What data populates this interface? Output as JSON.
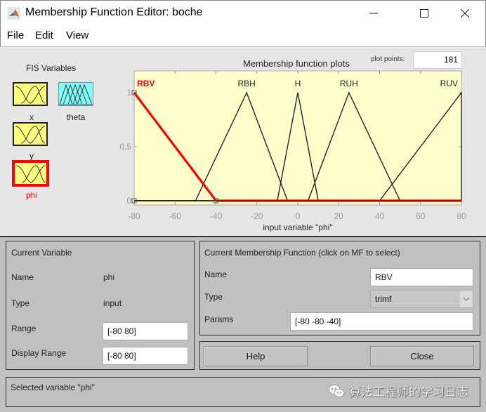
{
  "window": {
    "title": "Membership Function Editor: boche",
    "app_icon": "matlab-icon",
    "controls": [
      "minimize",
      "maximize",
      "close"
    ]
  },
  "menu": [
    {
      "label": "File"
    },
    {
      "label": "Edit"
    },
    {
      "label": "View"
    }
  ],
  "fis_variables": {
    "title": "FIS Variables",
    "items": [
      {
        "name": "x",
        "kind": "input",
        "color": "#ffff80",
        "selected": false
      },
      {
        "name": "theta",
        "kind": "output",
        "color": "#80ffff",
        "selected": false
      },
      {
        "name": "y",
        "kind": "input",
        "color": "#ffff80",
        "selected": false
      },
      {
        "name": "phi",
        "kind": "input",
        "color": "#ffff80",
        "selected": true
      }
    ],
    "selected_color": "#ff0000"
  },
  "plot_points": {
    "label": "plot points:",
    "value": "181"
  },
  "chart_data": {
    "type": "line",
    "title": "Membership function plots",
    "xlabel": "input variable \"phi\"",
    "ylabel": "",
    "xlim": [
      -80,
      80
    ],
    "ylim": [
      0,
      1
    ],
    "xticks": [
      "-80",
      "-60",
      "-40",
      "-20",
      "0",
      "20",
      "40",
      "60",
      "80"
    ],
    "yticks": [
      "0",
      "0.5",
      "1"
    ],
    "background": "#ffffcc",
    "selected_color": "#ff0000",
    "series": [
      {
        "name": "RBV",
        "mf_type": "trimf",
        "params": [
          -80,
          -80,
          -40
        ],
        "selected": true
      },
      {
        "name": "RBH",
        "mf_type": "trimf",
        "params": [
          -50,
          -25,
          -5
        ],
        "selected": false
      },
      {
        "name": "H",
        "mf_type": "trimf",
        "params": [
          -10,
          0,
          10
        ],
        "selected": false
      },
      {
        "name": "RUH",
        "mf_type": "trimf",
        "params": [
          5,
          25,
          50
        ],
        "selected": false
      },
      {
        "name": "RUV",
        "mf_type": "trimf",
        "params": [
          40,
          80,
          80
        ],
        "selected": false
      }
    ]
  },
  "current_variable": {
    "title": "Current Variable",
    "name_label": "Name",
    "name_value": "phi",
    "type_label": "Type",
    "type_value": "input",
    "range_label": "Range",
    "range_value": "[-80 80]",
    "display_range_label": "Display Range",
    "display_range_value": "[-80 80]"
  },
  "current_mf": {
    "title": "Current Membership Function (click on MF to select)",
    "name_label": "Name",
    "name_value": "RBV",
    "type_label": "Type",
    "type_value": "trimf",
    "params_label": "Params",
    "params_value": "[-80 -80 -40]"
  },
  "buttons": {
    "help": "Help",
    "close": "Close"
  },
  "status": {
    "text": "Selected variable \"phi\""
  },
  "watermark": {
    "text": "算法工程师的学习日志",
    "icon": "wechat-icon"
  }
}
